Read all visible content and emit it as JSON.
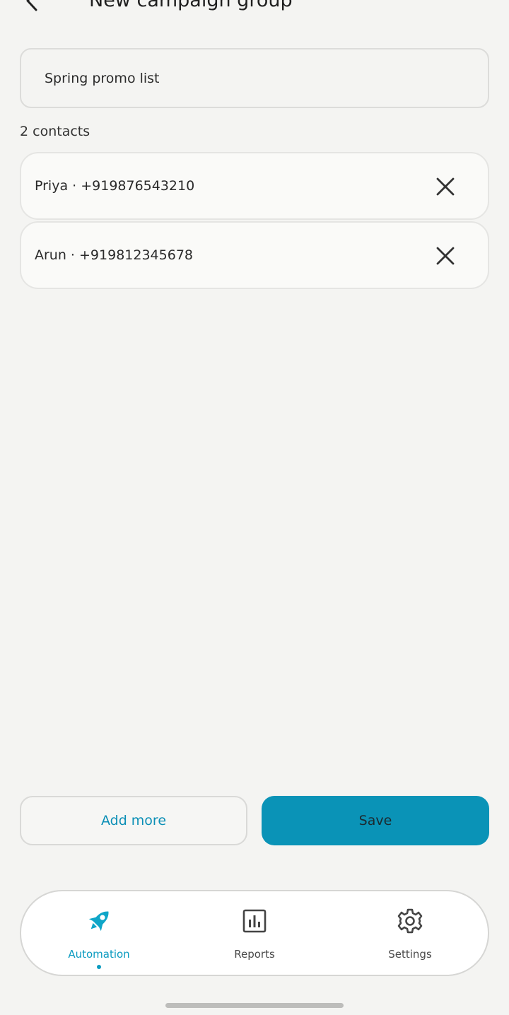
{
  "header": {
    "title": "New campaign group",
    "back_icon": "arrow-left-icon"
  },
  "form": {
    "group_name_value": "Spring promo list",
    "contact_count": "2 contacts"
  },
  "contacts": [
    {
      "label": "Priya · +919876543210"
    },
    {
      "label": "Arun · +919812345678"
    }
  ],
  "actions": {
    "add_more_label": "Add more",
    "save_label": "Save"
  },
  "nav": {
    "items": [
      {
        "label": "Automation",
        "icon": "rocket-icon",
        "active": true
      },
      {
        "label": "Reports",
        "icon": "bar-chart-icon",
        "active": false
      },
      {
        "label": "Settings",
        "icon": "gear-icon",
        "active": false
      }
    ]
  },
  "colors": {
    "accent": "#0a93b7",
    "background": "#f4f4f2"
  }
}
